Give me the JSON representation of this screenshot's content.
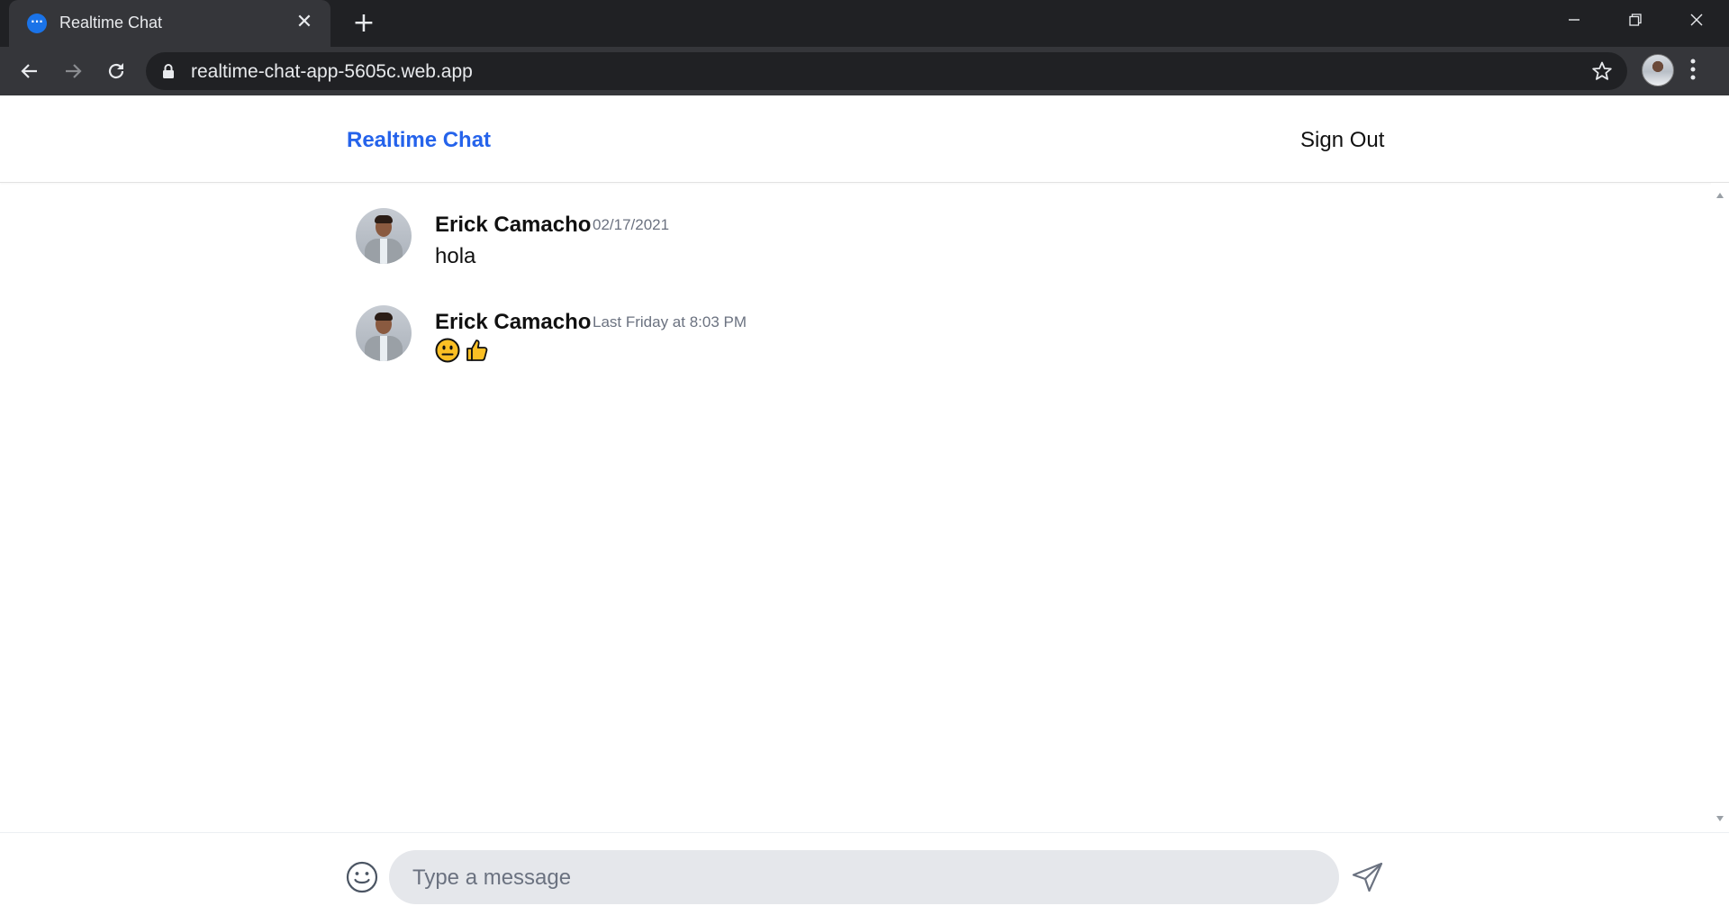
{
  "browser": {
    "tab_title": "Realtime Chat",
    "url": "realtime-chat-app-5605c.web.app",
    "favicon_glyph": "···"
  },
  "app": {
    "brand": "Realtime Chat",
    "sign_out_label": "Sign Out",
    "brand_color": "#2563eb"
  },
  "messages": [
    {
      "author": "Erick Camacho",
      "time": "02/17/2021",
      "text": "hola"
    },
    {
      "author": "Erick Camacho",
      "time": "Last Friday at 8:03 PM",
      "text": ""
    }
  ],
  "composer": {
    "placeholder": "Type a message"
  }
}
